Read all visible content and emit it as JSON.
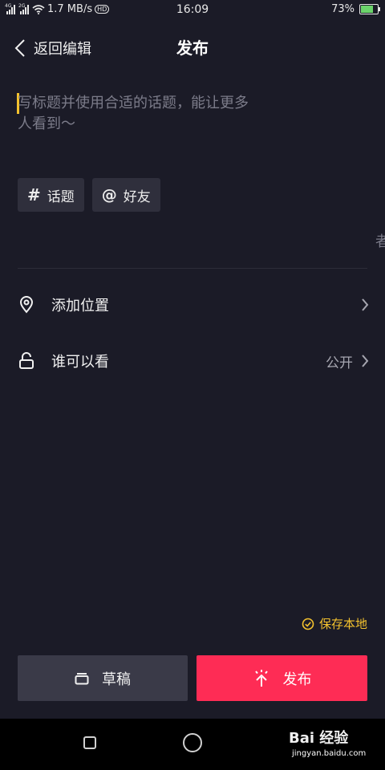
{
  "status_bar": {
    "network_left": "4G",
    "network_right": "2G",
    "speed": "1.7 MB/s",
    "hd": "HD",
    "time": "16:09",
    "battery_percent": "73%",
    "battery_level": 0.73
  },
  "header": {
    "back_label": "返回编辑",
    "title": "发布"
  },
  "caption": {
    "placeholder": "写标题并使用合适的话题，能让更多人看到～"
  },
  "chips": {
    "topic": "话题",
    "friend": "好友"
  },
  "edge_char": "者",
  "rows": {
    "location": "添加位置",
    "visibility": "谁可以看",
    "visibility_value": "公开"
  },
  "save_local": "保存本地",
  "buttons": {
    "draft": "草稿",
    "publish": "发布"
  },
  "watermark": {
    "brand": "Bai 经验",
    "url": "jingyan.baidu.com"
  },
  "colors": {
    "background": "#1b1b27",
    "accent": "#fe2c55",
    "highlight": "#f4c22e"
  }
}
